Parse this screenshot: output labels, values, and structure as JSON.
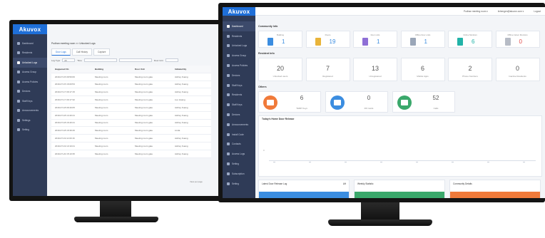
{
  "brand": "Akuvox",
  "colors": {
    "primary": "#1f6fd8",
    "sidebar": "#2f3b57",
    "orange": "#f07a3a",
    "green": "#3aa86b",
    "blue": "#3b8de0",
    "purple": "#8e6fd6",
    "teal": "#22b3a8",
    "red": "#e24a4a"
  },
  "left": {
    "sidebar": [
      {
        "label": "Dashboard",
        "active": false
      },
      {
        "label": "Residents",
        "active": false
      },
      {
        "label": "Unlocked Logs",
        "active": true
      },
      {
        "label": "Access Group",
        "active": false
      },
      {
        "label": "Access Policies",
        "active": false
      },
      {
        "label": "Devices",
        "active": false
      },
      {
        "label": "Staff Keys",
        "active": false
      },
      {
        "label": "Announcements",
        "active": false
      },
      {
        "label": "Settings",
        "active": false
      },
      {
        "label": "Setting",
        "active": false
      }
    ],
    "breadcrumb": "Pudhan meeting room >> Unlocked Logs",
    "tabs": [
      "Door Logs",
      "Call History",
      "Capture"
    ],
    "filter": {
      "log_type_label": "Log Type",
      "log_type_value": "All",
      "time_label": "Time",
      "door_unit_label": "Door Unit"
    },
    "table": {
      "headers": [
        "Happened On",
        "Building",
        "Door Unit",
        "Initiated By"
      ],
      "rows": [
        [
          "2019-07-15 09:50:06",
          "Meeting room",
          "Meeting room gate",
          "Ashley Kuang"
        ],
        [
          "2019-07-15 16:00:53",
          "Meeting room",
          "Meeting room gate",
          "Ashley Kuang"
        ],
        [
          "2019-07-17 09:17:15",
          "Meeting room",
          "Meeting room gate",
          "Ashley Kuang"
        ],
        [
          "2019-07-17 09:17:32",
          "Meeting room",
          "Meeting room gate",
          "Luo Huang"
        ],
        [
          "2019-07-18 09:40:05",
          "Meeting room",
          "Meeting room gate",
          "Ashley Kuang"
        ],
        [
          "2019-07-18 14:40:41",
          "Meeting room",
          "Meeting room gate",
          "Ashley Kuang"
        ],
        [
          "2019-07-18 16:40:41",
          "Meeting room",
          "Meeting room gate",
          "Ashley Kuang"
        ],
        [
          "2019-07-18 16:39:46",
          "Meeting room",
          "Meeting room gate",
          "Linda"
        ],
        [
          "2019-07-19 11:00:16",
          "Meeting room",
          "Meeting room gate",
          "Ashley Kuang"
        ],
        [
          "2019-07-19 13:10:21",
          "Meeting room",
          "Meeting room gate",
          "Ashley Kuang"
        ],
        [
          "2019-07-22 15:10:35",
          "Meeting room",
          "Meeting room gate",
          "Ashley Kuang"
        ]
      ]
    },
    "pager": "View per page"
  },
  "right": {
    "topbar": [
      "Pudhan meeting room ▾",
      "lichengen@akuvox.com ▾",
      "Logout"
    ],
    "sidebar": [
      "Dashboard",
      "Residents",
      "Unlocked Logs",
      "Access Group",
      "Access Policies",
      "Devices",
      "Staff Keys",
      "Residents",
      "Staff Keys",
      "Devices",
      "Announcements",
      "Install Code",
      "Contacts",
      "Access Logs",
      "Setting",
      "Subscription",
      "Setting"
    ],
    "community_title": "Community Info",
    "community": [
      {
        "label": "Building",
        "value": "1",
        "icon_color": "#3b8de0",
        "num_color": "#3b8de0"
      },
      {
        "label": "Floors",
        "value": "19",
        "icon_color": "#e9b43a",
        "num_color": "#3b8de0"
      },
      {
        "label": "Door units",
        "value": "1",
        "icon_color": "#8e6fd6",
        "num_color": "#3b8de0"
      },
      {
        "label": "Offline Door units",
        "value": "1",
        "icon_color": "#9aa6b8",
        "num_color": "#3b8de0"
      },
      {
        "label": "Online Monitors",
        "value": "6",
        "icon_color": "#22b3a8",
        "num_color": "#22b3a8"
      },
      {
        "label": "Offline Indoor Monitors",
        "value": "0",
        "icon_color": "#b7bcc6",
        "num_color": "#e24a4a"
      }
    ],
    "resident_title": "Resident Info",
    "residents": [
      {
        "value": "20",
        "label": "Unlocked users"
      },
      {
        "value": "7",
        "label": "Registered"
      },
      {
        "value": "13",
        "label": "Unregistered"
      },
      {
        "value": "6",
        "label": "Mobile Apps"
      },
      {
        "value": "2",
        "label": "Phone Numbers"
      },
      {
        "value": "0",
        "label": "Inactive Residents"
      }
    ],
    "others_title": "Others",
    "others": [
      {
        "value": "6",
        "label": "TEMP Keys",
        "color": "#f07a3a"
      },
      {
        "value": "0",
        "label": "RF Cards",
        "color": "#3b8de0"
      },
      {
        "value": "52",
        "label": "Calls",
        "color": "#3aa86b"
      }
    ],
    "chart_title": "Today's Home Door Release",
    "chart_tick": "0",
    "bottom_panels": [
      {
        "title": "Latest Door Release Log",
        "extra": "Lift",
        "color": "#3b8de0"
      },
      {
        "title": "Weekly Statistic",
        "extra": "",
        "color": "#3aa86b"
      },
      {
        "title": "Community Details",
        "extra": "",
        "color": "#f07a3a"
      }
    ]
  }
}
